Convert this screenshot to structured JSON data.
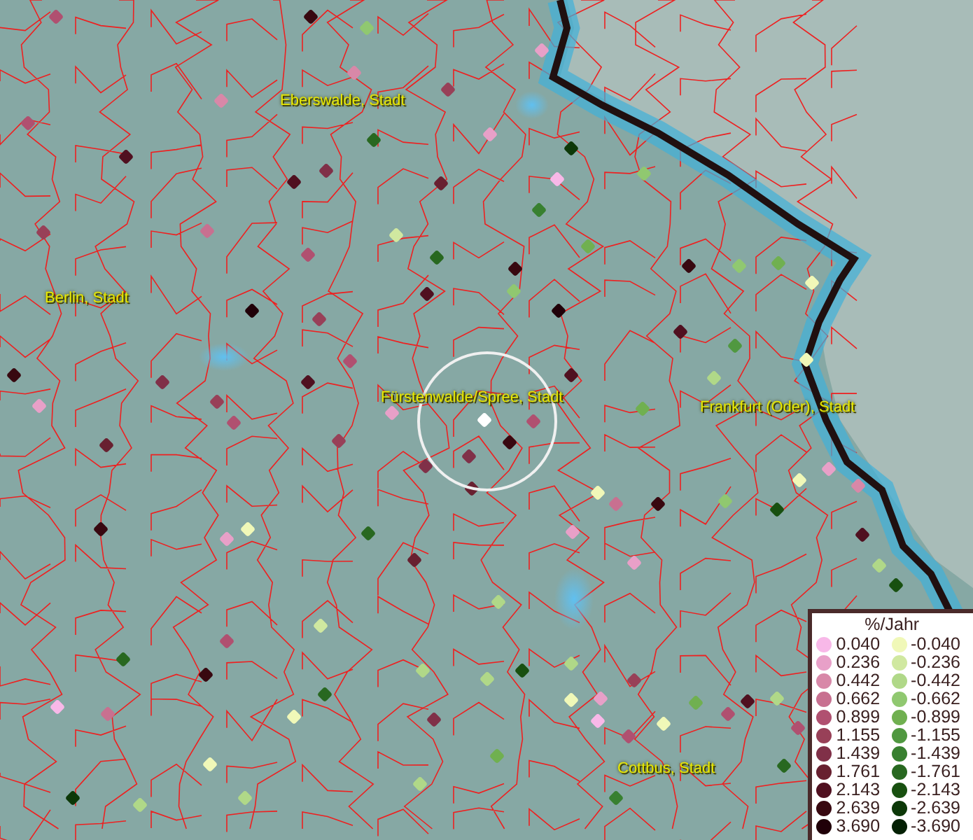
{
  "map": {
    "places": [
      {
        "name": "Eberswalde, Stadt"
      },
      {
        "name": "Berlin, Stadt"
      },
      {
        "name": "Fürstenwalde/Spree, Stadt"
      },
      {
        "name": "Frankfurt (Oder), Stadt"
      },
      {
        "name": "Cottbus, Stadt"
      }
    ]
  },
  "legend": {
    "title": "%/Jahr",
    "rows": [
      {
        "increase": {
          "value": "0.040",
          "color": "#f8b8e8"
        },
        "decrease": {
          "value": "-0.040",
          "color": "#f0f8b8"
        }
      },
      {
        "increase": {
          "value": "0.236",
          "color": "#e8a0c8"
        },
        "decrease": {
          "value": "-0.236",
          "color": "#d0e8a0"
        }
      },
      {
        "increase": {
          "value": "0.442",
          "color": "#d888a8"
        },
        "decrease": {
          "value": "-0.442",
          "color": "#b0d888"
        }
      },
      {
        "increase": {
          "value": "0.662",
          "color": "#c87090"
        },
        "decrease": {
          "value": "-0.662",
          "color": "#90c870"
        }
      },
      {
        "increase": {
          "value": "0.899",
          "color": "#b05070"
        },
        "decrease": {
          "value": "-0.899",
          "color": "#70b050"
        }
      },
      {
        "increase": {
          "value": "1.155",
          "color": "#984058"
        },
        "decrease": {
          "value": "-1.155",
          "color": "#509840"
        }
      },
      {
        "increase": {
          "value": "1.439",
          "color": "#803048"
        },
        "decrease": {
          "value": "-1.439",
          "color": "#388030"
        }
      },
      {
        "increase": {
          "value": "1.761",
          "color": "#682030"
        },
        "decrease": {
          "value": "-1.761",
          "color": "#286820"
        }
      },
      {
        "increase": {
          "value": "2.143",
          "color": "#501020"
        },
        "decrease": {
          "value": "-2.143",
          "color": "#185010"
        }
      },
      {
        "increase": {
          "value": "2.639",
          "color": "#380810"
        },
        "decrease": {
          "value": "-2.639",
          "color": "#0c3808"
        }
      },
      {
        "increase": {
          "value": "3.690",
          "color": "#200008"
        },
        "decrease": {
          "value": "-3.690",
          "color": "#042004"
        }
      }
    ]
  }
}
